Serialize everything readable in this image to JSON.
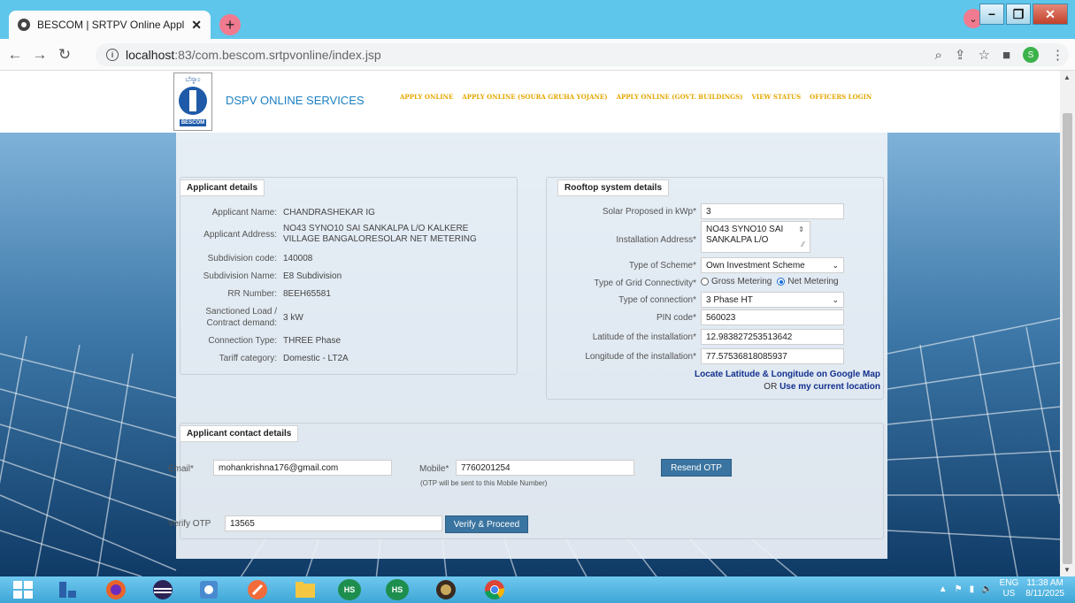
{
  "browser": {
    "tab_title": "BESCOM | SRTPV Online Applicat",
    "tab_close": "✕",
    "new_tab": "+",
    "url_host": "localhost",
    "url_rest": ":83/com.bescom.srtpvonline/index.jsp"
  },
  "header": {
    "site_title": "DSPV ONLINE SERVICES",
    "logo_top": "ಬೆಸ್ಕಾಂ",
    "logo_name": "BESCOM",
    "nav": [
      "APPLY ONLINE",
      "APPLY ONLINE (SOURA GRUHA YOJANE)",
      "APPLY ONLINE (GOVT. BUILDINGS)",
      "VIEW STATUS",
      "OFFICERS LOGIN"
    ]
  },
  "applicant": {
    "section_title": "Applicant details",
    "name_label": "Applicant Name:",
    "name": "CHANDRASHEKAR IG",
    "address_label": "Applicant Address:",
    "address": "NO43 SYNO10 SAI SANKALPA L/O KALKERE VILLAGE BANGALORESOLAR NET METERING",
    "subdiv_code_label": "Subdivision code:",
    "subdiv_code": "140008",
    "subdiv_name_label": "Subdivision Name:",
    "subdiv_name": "E8 Subdivision",
    "rr_label": "RR Number:",
    "rr": "8EEH65581",
    "load_label": "Sanctioned Load / Contract demand:",
    "load": "3 kW",
    "conn_type_label": "Connection Type:",
    "conn_type": "THREE Phase",
    "tariff_label": "Tariff category:",
    "tariff": "Domestic - LT2A"
  },
  "rooftop": {
    "section_title": "Rooftop system details",
    "solar_label": "Solar Proposed in kWp*",
    "solar": "3",
    "install_addr_label": "Installation Address*",
    "install_addr": "NO43 SYNO10 SAI SANKALPA L/O",
    "scheme_label": "Type of Scheme*",
    "scheme": "Own Investment Scheme",
    "grid_label": "Type of Grid Connectivity*",
    "grid_gross": "Gross Metering",
    "grid_net": "Net Metering",
    "connection_label": "Type of connection*",
    "connection": "3 Phase HT",
    "pin_label": "PIN code*",
    "pin": "560023",
    "lat_label": "Latitude of the installation*",
    "lat": "12.983827253513642",
    "lng_label": "Longitude of the installation*",
    "lng": "77.57536818085937",
    "map_link": "Locate Latitude & Longitude on Google Map",
    "or_text": "OR",
    "current_location_link": "Use my current location"
  },
  "contact": {
    "section_title": "Applicant contact details",
    "email_label": "Email*",
    "email": "mohankrishna176@gmail.com",
    "mobile_label": "Mobile*",
    "mobile": "7760201254",
    "otp_note": "(OTP will be sent to this Mobile Number)",
    "resend_otp": "Resend OTP",
    "verify_label": "Verify OTP",
    "otp": "13565",
    "verify_button": "Verify & Proceed"
  },
  "taskbar": {
    "lang_top": "ENG",
    "lang_bottom": "US",
    "time": "11:38 AM",
    "date": "8/11/2025"
  }
}
